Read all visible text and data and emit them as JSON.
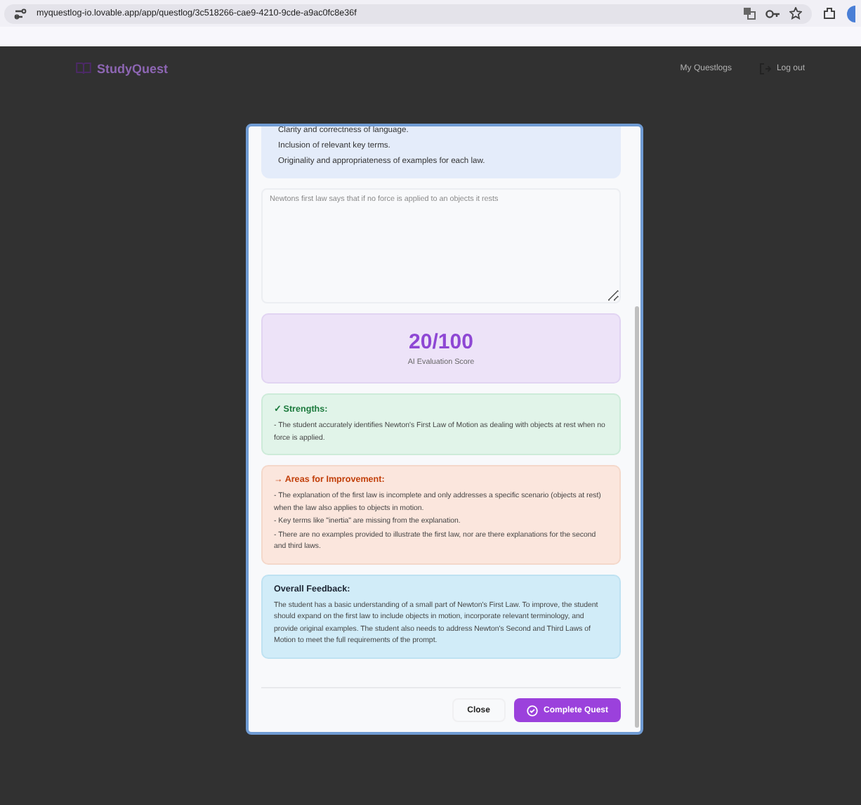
{
  "browser": {
    "url": "myquestlog-io.lovable.app/app/questlog/3c518266-cae9-4210-9cde-a9ac0fc8e36f"
  },
  "nav": {
    "logo": "StudyQuest",
    "links": [
      {
        "label": "My Questlogs",
        "kind": "link"
      },
      {
        "label": "Log out",
        "kind": "logout"
      }
    ]
  },
  "dialog": {
    "criteria": [
      "Clarity and correctness of language.",
      "Inclusion of relevant key terms.",
      "Originality and appropriateness of examples for each law."
    ],
    "answer": {
      "value": "Newtons first law says that if no force is applied to an objects it rests"
    },
    "score": {
      "value": "20/100",
      "label": "AI Evaluation Score"
    },
    "sections": [
      {
        "kind": "strengths",
        "title": "✓ Strengths:",
        "items": [
          "- The student accurately identifies Newton's First Law of Motion as dealing with objects at rest when no force is applied."
        ]
      },
      {
        "kind": "improvement",
        "title": "→ Areas for Improvement:",
        "items": [
          "- The explanation of the first law is incomplete and only addresses a specific scenario (objects at rest) when the law also applies to objects in motion.",
          "- Key terms like \"inertia\" are missing from the explanation.",
          "- There are no examples provided to illustrate the first law, nor are there explanations for the second and third laws."
        ]
      },
      {
        "kind": "overall",
        "title": "Overall Feedback:",
        "items": [
          "The student has a basic understanding of a small part of Newton's First Law. To improve, the student should expand on the first law to include objects in motion, incorporate relevant terminology, and provide original examples. The student also needs to address Newton's Second and Third Laws of Motion to meet the full requirements of the prompt."
        ]
      }
    ],
    "buttons": [
      {
        "label": "Close",
        "kind": "secondary"
      },
      {
        "label": "Complete Quest",
        "kind": "primary"
      }
    ]
  }
}
